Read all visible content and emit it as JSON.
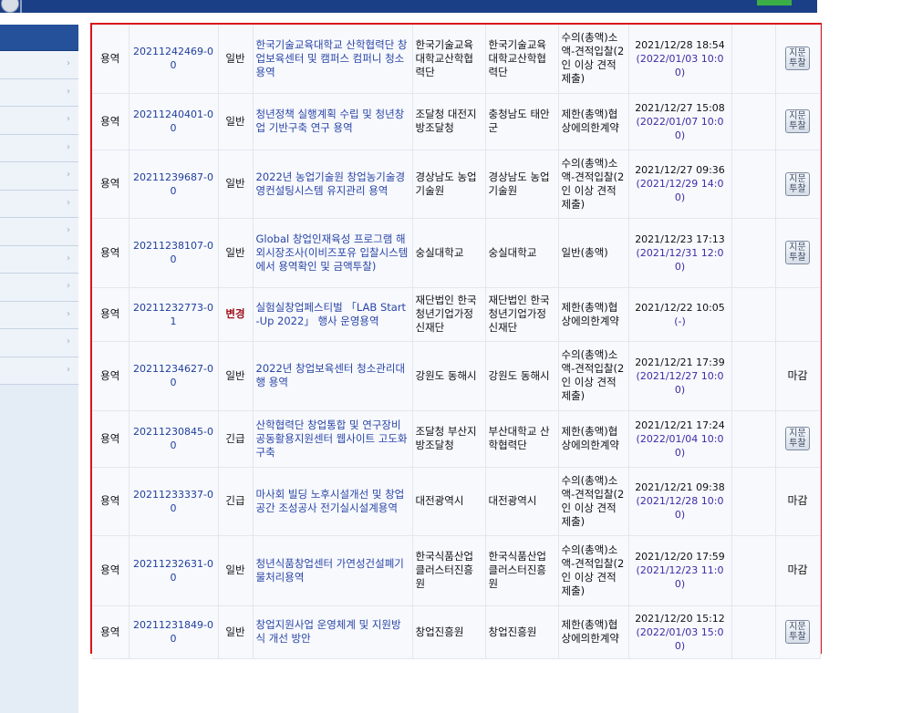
{
  "header": {},
  "sidebar": {
    "item_count": 12
  },
  "table": {
    "rows": [
      {
        "type": "용역",
        "no": "20211242469-00",
        "kind": "일반",
        "name": "한국기술교육대학교 산학협력단 창업보육센터 및 캠퍼스 컴퍼니 청소용역",
        "agency": "한국기술교육대학교산학협력단",
        "demand": "한국기술교육대학교산학협력단",
        "contract": "수의(총액)소액-견적입찰(2인 이상 견적 제출)",
        "posted": "2021/12/28 18:54",
        "deadline": "(2022/01/03 10:00)",
        "action": "inquiry",
        "action_label": "지문\n투찰"
      },
      {
        "type": "용역",
        "no": "20211240401-00",
        "kind": "일반",
        "name": "청년정책 실행계획 수립 및 청년창업 기반구축 연구 용역",
        "agency": "조달청 대전지방조달청",
        "demand": "충청남도 태안군",
        "contract": "제한(총액)협상에의한계약",
        "posted": "2021/12/27 15:08",
        "deadline": "(2022/01/07 10:00)",
        "action": "inquiry",
        "action_label": "지문\n투찰"
      },
      {
        "type": "용역",
        "no": "20211239687-00",
        "kind": "일반",
        "name": "2022년 농업기술원 창업농기술경영컨설팅시스템 유지관리 용역",
        "agency": "경상남도 농업기술원",
        "demand": "경상남도 농업기술원",
        "contract": "수의(총액)소액-견적입찰(2인 이상 견적 제출)",
        "posted": "2021/12/27 09:36",
        "deadline": "(2021/12/29 14:00)",
        "action": "inquiry",
        "action_label": "지문\n투찰"
      },
      {
        "type": "용역",
        "no": "20211238107-00",
        "kind": "일반",
        "name": "Global 창업인재육성 프로그램 해외시장조사(이비즈포유 입찰시스템에서 용역확인 및 금액투찰)",
        "agency": "숭실대학교",
        "demand": "숭실대학교",
        "contract": "일반(총액)",
        "posted": "2021/12/23 17:13",
        "deadline": "(2021/12/31 12:00)",
        "action": "inquiry",
        "action_label": "지문\n투찰"
      },
      {
        "type": "용역",
        "no": "20211232773-01",
        "kind": "변경",
        "urgent": true,
        "name": "실험실창업페스티벌 「LAB Start-Up 2022」 행사 운영용역",
        "agency": "재단법인 한국청년기업가정신재단",
        "demand": "재단법인 한국청년기업가정신재단",
        "contract": "제한(총액)협상에의한계약",
        "posted": "2021/12/22 10:05",
        "deadline": "(-)",
        "action": "none",
        "action_label": ""
      },
      {
        "type": "용역",
        "no": "20211234627-00",
        "kind": "일반",
        "name": "2022년 창업보육센터 청소관리대행 용역",
        "agency": "강원도 동해시",
        "demand": "강원도 동해시",
        "contract": "수의(총액)소액-견적입찰(2인 이상 견적 제출)",
        "posted": "2021/12/21 17:39",
        "deadline": "(2021/12/27 10:00)",
        "action": "closed",
        "action_label": "마감"
      },
      {
        "type": "용역",
        "no": "20211230845-00",
        "kind": "긴급",
        "name": "산학협력단 창업통합 및 연구장비공동활용지원센터 웹사이트 고도화 구축",
        "agency": "조달청 부산지방조달청",
        "demand": "부산대학교 산학협력단",
        "contract": "제한(총액)협상에의한계약",
        "posted": "2021/12/21 17:24",
        "deadline": "(2022/01/04 10:00)",
        "action": "inquiry",
        "action_label": "지문\n투찰"
      },
      {
        "type": "용역",
        "no": "20211233337-00",
        "kind": "긴급",
        "name": "마사회 빌딩 노후시설개선 및 창업공간 조성공사 전기실시설계용역",
        "agency": "대전광역시",
        "demand": "대전광역시",
        "contract": "수의(총액)소액-견적입찰(2인 이상 견적 제출)",
        "posted": "2021/12/21 09:38",
        "deadline": "(2021/12/28 10:00)",
        "action": "closed",
        "action_label": "마감"
      },
      {
        "type": "용역",
        "no": "20211232631-00",
        "kind": "일반",
        "name": "청년식품창업센터 가연성건설폐기물처리용역",
        "agency": "한국식품산업클러스터진흥원",
        "demand": "한국식품산업클러스터진흥원",
        "contract": "수의(총액)소액-견적입찰(2인 이상 견적 제출)",
        "posted": "2021/12/20 17:59",
        "deadline": "(2021/12/23 11:00)",
        "action": "closed",
        "action_label": "마감"
      },
      {
        "type": "용역",
        "no": "20211231849-00",
        "kind": "일반",
        "name": "창업지원사업 운영체계 및 지원방식 개선 방안",
        "agency": "창업진흥원",
        "demand": "창업진흥원",
        "contract": "제한(총액)협상에의한계약",
        "posted": "2021/12/20 15:12",
        "deadline": "(2022/01/03 15:00)",
        "action": "inquiry",
        "action_label": "지문\n투찰"
      }
    ]
  }
}
